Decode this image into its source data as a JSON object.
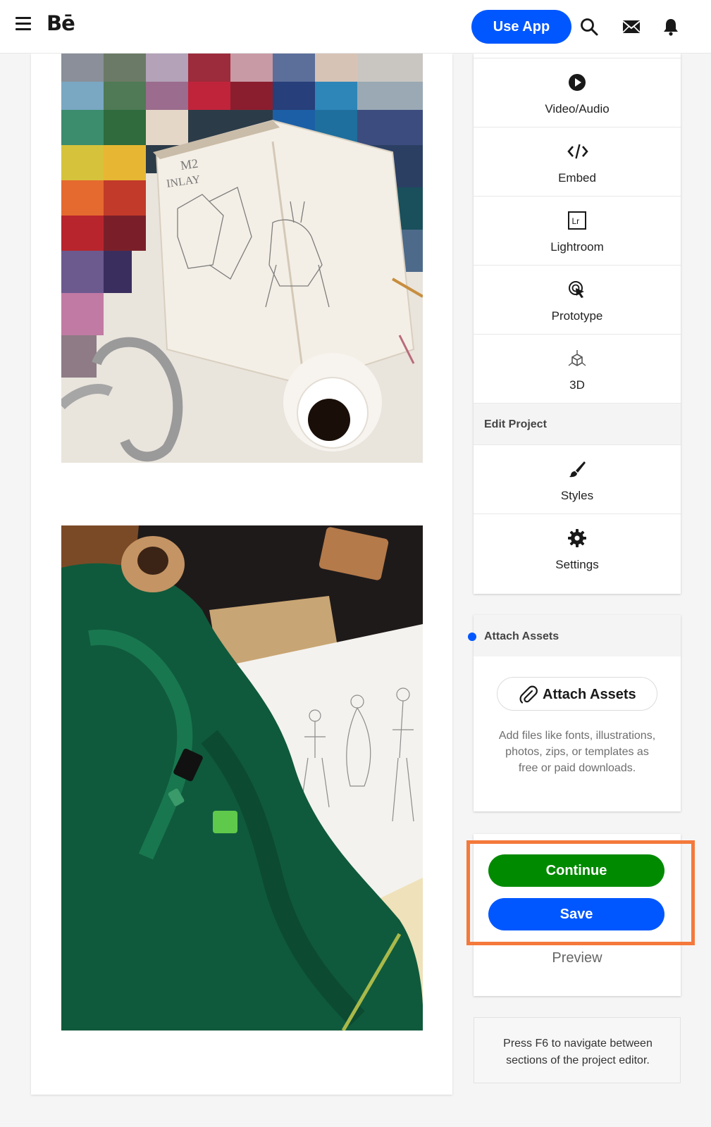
{
  "header": {
    "logo": "Bē",
    "use_app": "Use App",
    "icons": [
      "menu-icon",
      "search-icon",
      "mail-icon",
      "bell-icon"
    ]
  },
  "tools": [
    {
      "label": "Video/Audio",
      "icon": "play-icon"
    },
    {
      "label": "Embed",
      "icon": "code-icon"
    },
    {
      "label": "Lightroom",
      "icon": "lightroom-icon"
    },
    {
      "label": "Prototype",
      "icon": "cursor-click-icon"
    },
    {
      "label": "3D",
      "icon": "cube-icon"
    }
  ],
  "edit_project": {
    "title": "Edit Project",
    "items": [
      {
        "label": "Styles",
        "icon": "brush-icon"
      },
      {
        "label": "Settings",
        "icon": "gear-icon"
      }
    ]
  },
  "assets": {
    "section_title": "Attach Assets",
    "button_label": "Attach Assets",
    "description": "Add files like fonts, illustrations, photos, zips, or templates as free or paid downloads."
  },
  "actions": {
    "continue_label": "Continue",
    "save_label": "Save",
    "preview_label": "Preview"
  },
  "hint": "Press F6 to navigate between sections of the project editor.",
  "colors": {
    "brand_blue": "#0057ff",
    "continue_green": "#008a00",
    "highlight_orange": "#f4793b"
  }
}
